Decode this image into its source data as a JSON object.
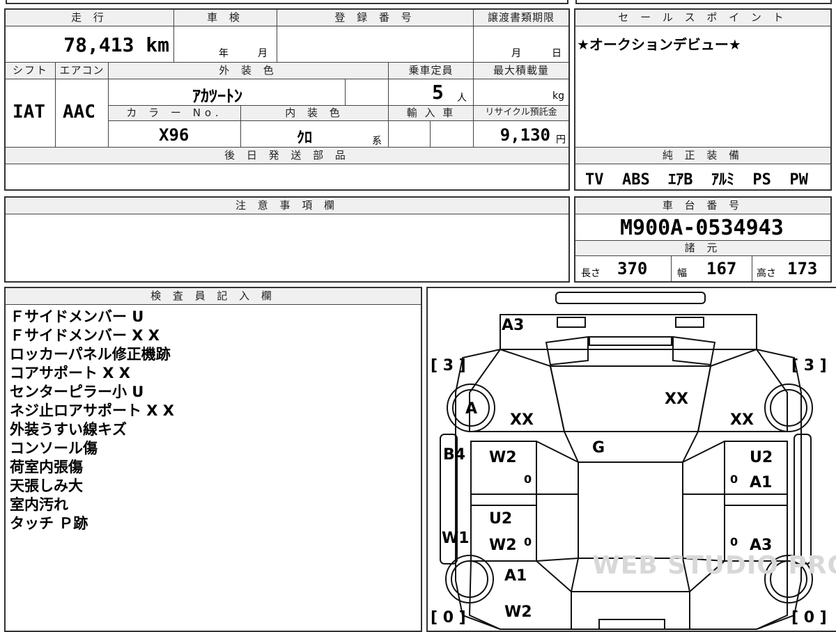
{
  "vehicle": {
    "mileage_label": "走 行",
    "mileage_value": "78,413 km",
    "inspection_label": "車 検",
    "inspection_year": "年",
    "inspection_month": "月",
    "registration_label": "登 録 番 号",
    "transfer_label": "譲渡書類期限",
    "transfer_month": "月",
    "transfer_day": "日",
    "shift_label": "シフト",
    "shift_value": "IAT",
    "aircon_label": "エアコン",
    "aircon_value": "AAC",
    "exterior_color_label": "外 装 色",
    "exterior_color_value": "ｱｶﾂｰﾄﾝ",
    "capacity_label": "乗車定員",
    "capacity_value": "5",
    "capacity_unit": "人",
    "max_load_label": "最大積載量",
    "max_load_unit": "kg",
    "color_no_label": "カ ラ ー No.",
    "color_no_value": "X96",
    "interior_color_label": "内 装 色",
    "interior_color_value": "ｸﾛ",
    "interior_color_suffix": "系",
    "import_label": "輸 入 車",
    "recycle_label": "リサイクル預託金",
    "recycle_value": "9,130",
    "recycle_unit": "円",
    "later_parts_label": "後 日 発 送 部 品"
  },
  "sales_point": {
    "label": "セ ー ル ス ポ イ ン ト",
    "text": "★オークションデビュー★"
  },
  "equipment": {
    "label": "純 正 装 備",
    "items": "TV  ABS  ｴｱB  ｱﾙﾐ  PS  PW"
  },
  "caution": {
    "label": "注 意 事 項 欄"
  },
  "chassis": {
    "label": "車 台 番 号",
    "value": "M900A-0534943",
    "specs_label": "諸 元",
    "length_label": "長さ",
    "length_value": "370",
    "width_label": "幅",
    "width_value": "167",
    "height_label": "高さ",
    "height_value": "173"
  },
  "inspector": {
    "label": "検 査 員 記 入 欄",
    "notes": [
      "Ｆサイドメンバー U",
      "Ｆサイドメンバー X X",
      "ロッカーパネル修正機跡",
      "コアサポート X X",
      "センターピラー小 U",
      "ネジ止ロアサポート X X",
      "外装うすい線キズ",
      "コンソール傷",
      "荷室内張傷",
      "天張しみ大",
      "室内汚れ",
      "タッチ Ｐ跡"
    ]
  },
  "diagram": {
    "marks": {
      "top_front": "A3",
      "hood": "XX",
      "left_fender_tire": "A",
      "left_fender": "XX",
      "right_fender": "XX",
      "windshield": "G",
      "left_front_door": "W2",
      "left_pillar": "B4",
      "right_front_door": "U2",
      "right_front_door_2": "A1",
      "left_rear_door_1": "U2",
      "left_rear_door_2": "W2",
      "left_rocker": "W1",
      "right_rear_door": "A3",
      "left_rear_quarter": "A1",
      "left_rear_bottom": "W2",
      "door_zero_1": "0",
      "door_zero_2": "0",
      "door_zero_3": "0",
      "door_zero_4": "0",
      "tread_fl": "[ 3 ]",
      "tread_fr": "[ 3 ]",
      "tread_rl": "[ 0 ]",
      "tread_rr": "[ 0 ]"
    },
    "watermark": "WEB STUDIO PRO"
  }
}
